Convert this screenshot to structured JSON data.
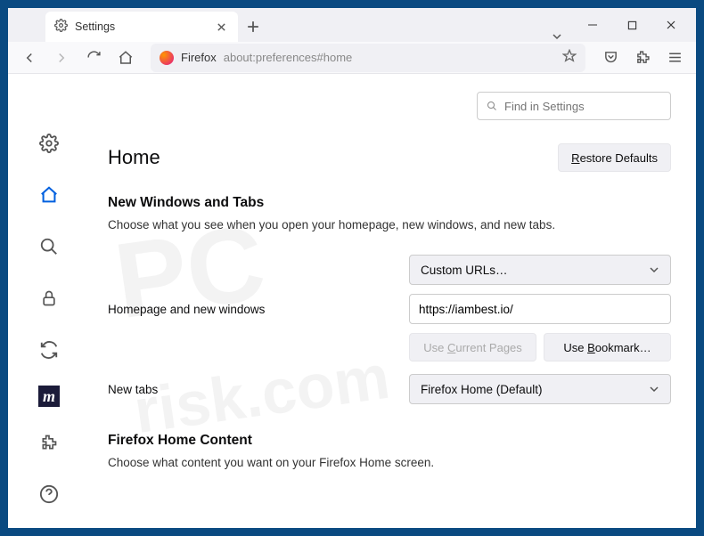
{
  "tab": {
    "title": "Settings"
  },
  "url": {
    "prefix": "Firefox",
    "path": "about:preferences#home"
  },
  "search": {
    "placeholder": "Find in Settings"
  },
  "heading": "Home",
  "buttons": {
    "restore": "Restore Defaults",
    "restore_u": "R",
    "use_current": "Use Current Pages",
    "use_current_u": "C",
    "use_bookmark": "Use Bookmark…",
    "use_bookmark_u": "B"
  },
  "section1": {
    "title": "New Windows and Tabs",
    "desc": "Choose what you see when you open your homepage, new windows, and new tabs."
  },
  "form": {
    "homepage_label": "Homepage and new windows",
    "homepage_select": "Custom URLs…",
    "homepage_value": "https://iambest.io/",
    "newtabs_label": "New tabs",
    "newtabs_select": "Firefox Home (Default)"
  },
  "section2": {
    "title": "Firefox Home Content",
    "desc": "Choose what content you want on your Firefox Home screen."
  }
}
